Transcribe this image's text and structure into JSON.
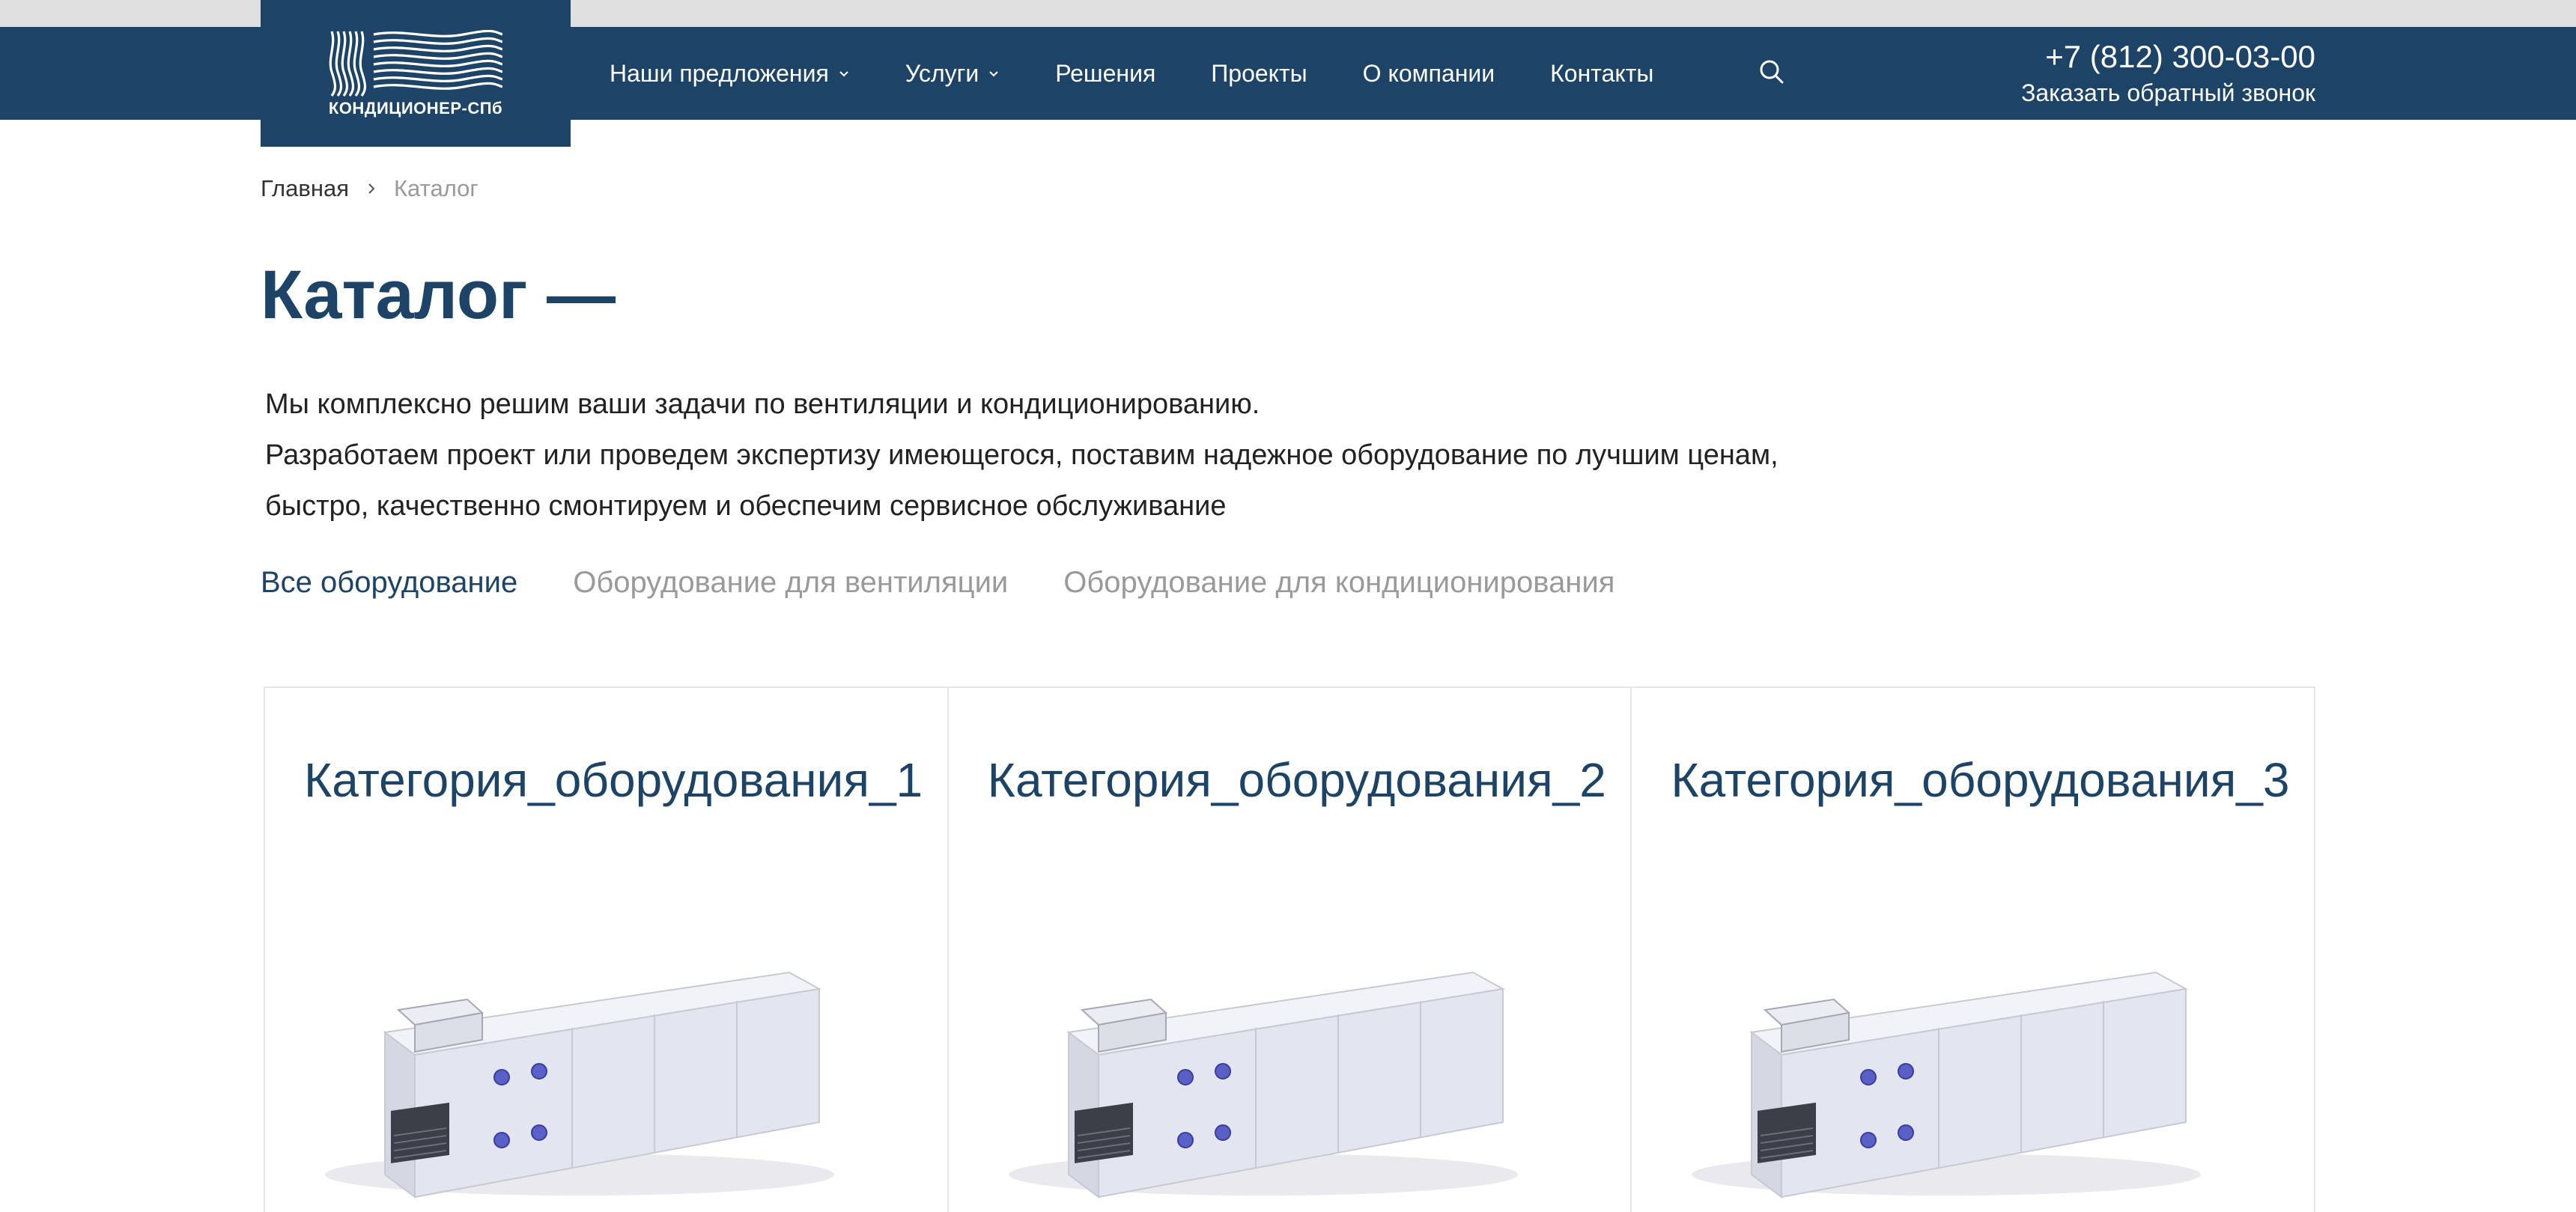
{
  "header": {
    "logo_text": "КОНДИЦИОНЕР-СПб",
    "menu": [
      {
        "label": "Наши предложения",
        "has_dropdown": true
      },
      {
        "label": "Услуги",
        "has_dropdown": true
      },
      {
        "label": "Решения",
        "has_dropdown": false
      },
      {
        "label": "Проекты",
        "has_dropdown": false
      },
      {
        "label": "О компании",
        "has_dropdown": false
      },
      {
        "label": "Контакты",
        "has_dropdown": false
      }
    ],
    "search_icon": "search-icon",
    "phone": "+7 (812) 300-03-00",
    "callback_label": "Заказать обратный звонок"
  },
  "breadcrumb": {
    "home": "Главная",
    "current": "Каталог"
  },
  "page": {
    "title": "Каталог —",
    "intro": [
      "Мы комплексно решим ваши задачи по вентиляции и кондиционированию.",
      "Разработаем проект или проведем экспертизу имеющегося, поставим надежное оборудование по лучшим ценам,",
      "быстро, качественно смонтируем и обеспечим сервисное обслуживание"
    ]
  },
  "filters": {
    "items": [
      "Все оборудование",
      "Оборудование для вентиляции",
      "Оборудование для кондиционирования"
    ],
    "active_index": 0
  },
  "catalog": {
    "cards": [
      {
        "title": "Категория_оборудования_1",
        "image": "air-handling-unit"
      },
      {
        "title": "Категория_оборудования_2",
        "image": "air-handling-unit"
      },
      {
        "title": "Категория_оборудования_3",
        "image": "air-handling-unit"
      }
    ]
  },
  "colors": {
    "brand": "#1d4467",
    "muted": "#9a9a9a",
    "top_strip": "#e0e0e0",
    "border": "#e6e6e6"
  }
}
